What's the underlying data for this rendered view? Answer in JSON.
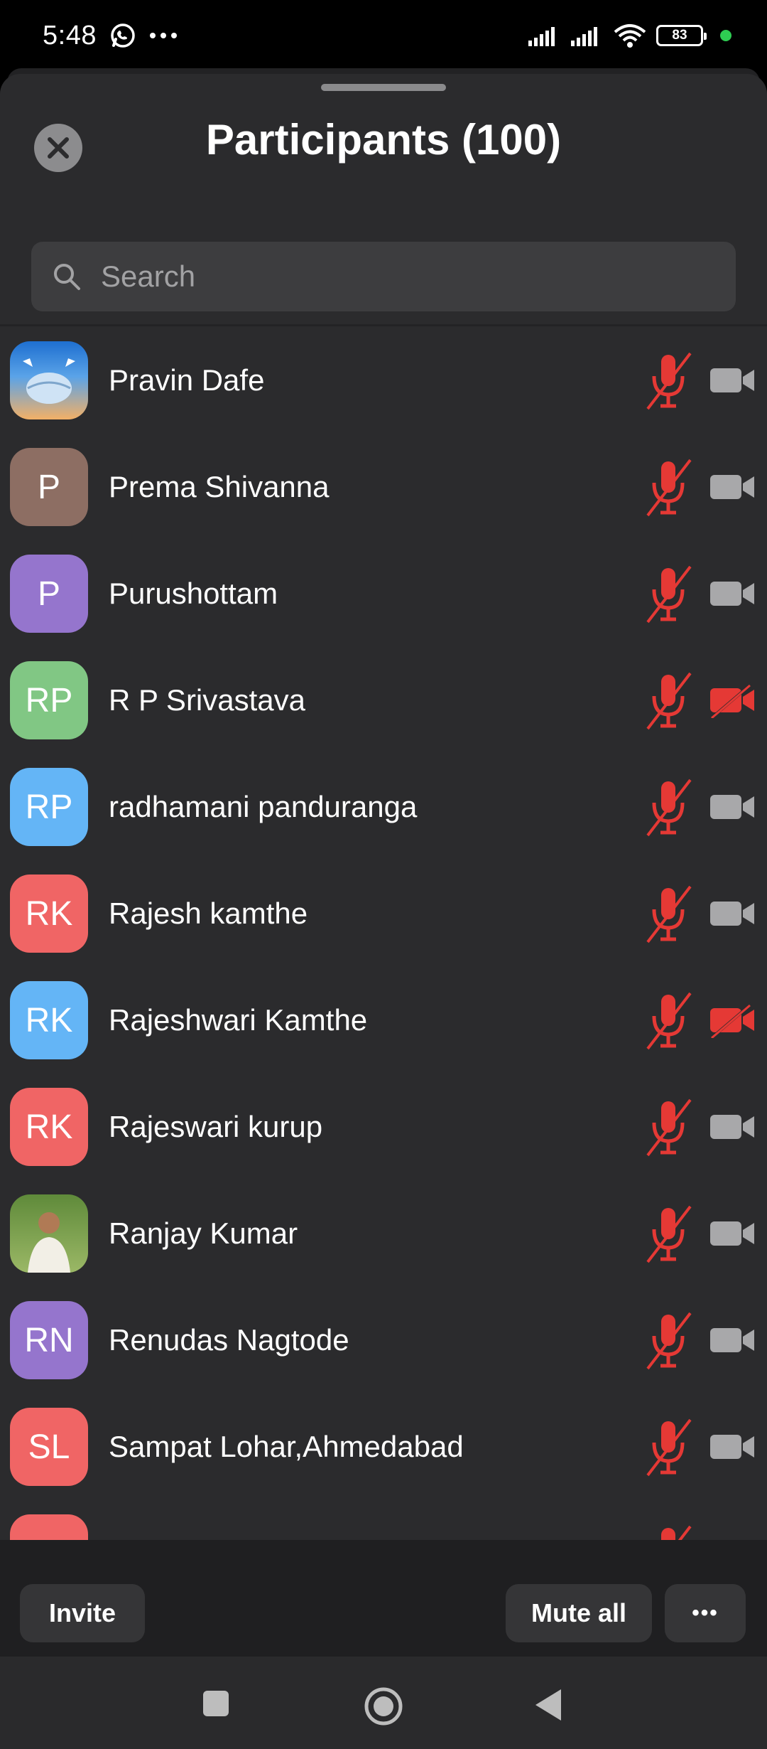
{
  "status": {
    "time": "5:48",
    "battery": "83"
  },
  "header": {
    "title": "Participants (100)"
  },
  "search": {
    "placeholder": "Search"
  },
  "participants": [
    {
      "name": "Pravin Dafe",
      "initials": "",
      "avatar": "photo-landscape",
      "color": "#f4a04a",
      "video_off": false
    },
    {
      "name": "Prema Shivanna",
      "initials": "P",
      "avatar": "initials",
      "color": "#8d6e63",
      "video_off": false
    },
    {
      "name": "Purushottam",
      "initials": "P",
      "avatar": "initials",
      "color": "#9575cd",
      "video_off": false
    },
    {
      "name": "R P Srivastava",
      "initials": "RP",
      "avatar": "initials",
      "color": "#81c784",
      "video_off": true
    },
    {
      "name": "radhamani panduranga",
      "initials": "RP",
      "avatar": "initials",
      "color": "#64b5f6",
      "video_off": false
    },
    {
      "name": "Rajesh kamthe",
      "initials": "RK",
      "avatar": "initials",
      "color": "#f06565",
      "video_off": false
    },
    {
      "name": "Rajeshwari Kamthe",
      "initials": "RK",
      "avatar": "initials",
      "color": "#64b5f6",
      "video_off": true
    },
    {
      "name": "Rajeswari kurup",
      "initials": "RK",
      "avatar": "initials",
      "color": "#f06565",
      "video_off": false
    },
    {
      "name": "Ranjay Kumar",
      "initials": "",
      "avatar": "photo-person",
      "color": "#6b8c4a",
      "video_off": false
    },
    {
      "name": "Renudas Nagtode",
      "initials": "RN",
      "avatar": "initials",
      "color": "#9575cd",
      "video_off": false
    },
    {
      "name": "Sampat Lohar,Ahmedabad",
      "initials": "SL",
      "avatar": "initials",
      "color": "#f06565",
      "video_off": false
    },
    {
      "name": "",
      "initials": "",
      "avatar": "initials",
      "color": "#f06565",
      "video_off": false
    }
  ],
  "footer": {
    "invite_label": "Invite",
    "mute_all_label": "Mute all",
    "more_label": "•••"
  },
  "icons": {
    "mic": "mic-muted-icon",
    "video_on": "video-icon",
    "video_off": "video-off-icon"
  },
  "colors": {
    "muted_red": "#e53935",
    "icon_gray": "#a8a8aa"
  }
}
